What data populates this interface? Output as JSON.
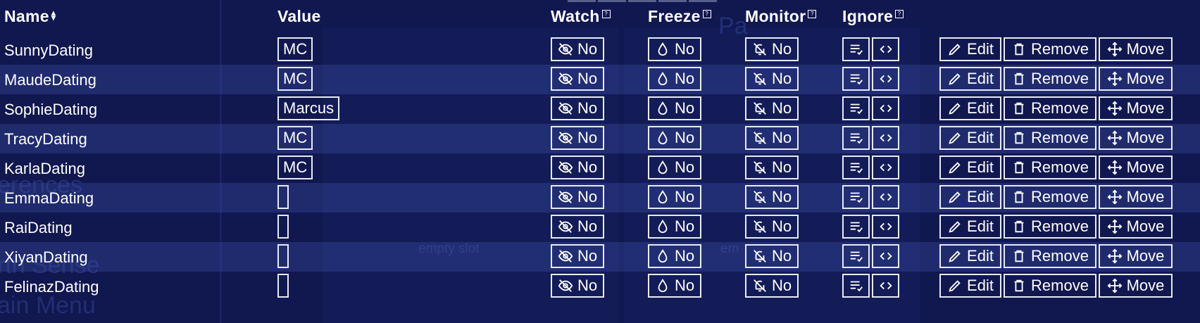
{
  "background": {
    "texts": [
      "Pa",
      "erences",
      "rth Sense",
      "ain Menu"
    ],
    "slots": [
      "empty slot",
      "em"
    ]
  },
  "headers": {
    "name": "Name",
    "value": "Value",
    "watch": "Watch",
    "freeze": "Freeze",
    "monitor": "Monitor",
    "ignore": "Ignore",
    "help_glyph": "?"
  },
  "labels": {
    "no": "No",
    "edit": "Edit",
    "remove": "Remove",
    "move": "Move"
  },
  "icons": {
    "watch": "eye-off-icon",
    "freeze": "droplet-icon",
    "monitor": "bell-off-icon",
    "ignore_a": "list-check-icon",
    "ignore_b": "code-icon",
    "edit": "pencil-icon",
    "remove": "trash-icon",
    "move": "move-arrows-icon"
  },
  "rows": [
    {
      "name": "SunnyDating",
      "value": "MC"
    },
    {
      "name": "MaudeDating",
      "value": "MC"
    },
    {
      "name": "SophieDating",
      "value": "Marcus"
    },
    {
      "name": "TracyDating",
      "value": "MC"
    },
    {
      "name": "KarlaDating",
      "value": "MC"
    },
    {
      "name": "EmmaDating",
      "value": ""
    },
    {
      "name": "RaiDating",
      "value": ""
    },
    {
      "name": "XiyanDating",
      "value": ""
    },
    {
      "name": "FelinazDating",
      "value": ""
    }
  ]
}
